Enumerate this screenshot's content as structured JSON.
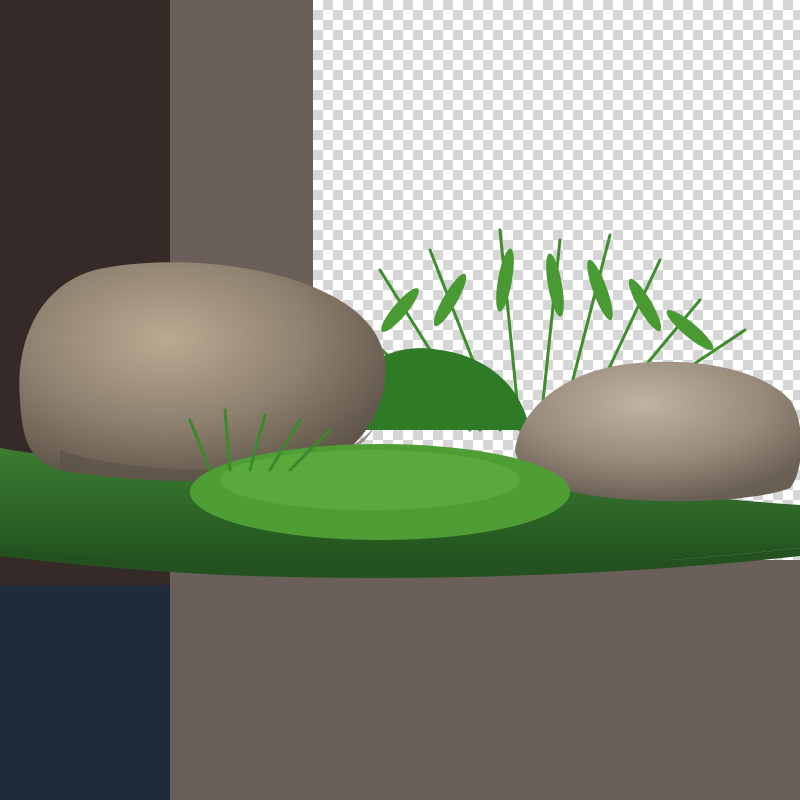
{
  "background": {
    "panel_dark_brown_color": "#352a27",
    "panel_navy_color": "#1f2b38",
    "panel_taupe_color": "#6b5f59",
    "transparency_checker_colors": [
      "#ffffff",
      "#d6d6d6"
    ]
  },
  "scene": {
    "grass_color": "#2f6e2a",
    "rock_color": "#9a8c7b",
    "fern_color": "#3f8d2e",
    "ground_cover_color": "#4f9e35"
  }
}
